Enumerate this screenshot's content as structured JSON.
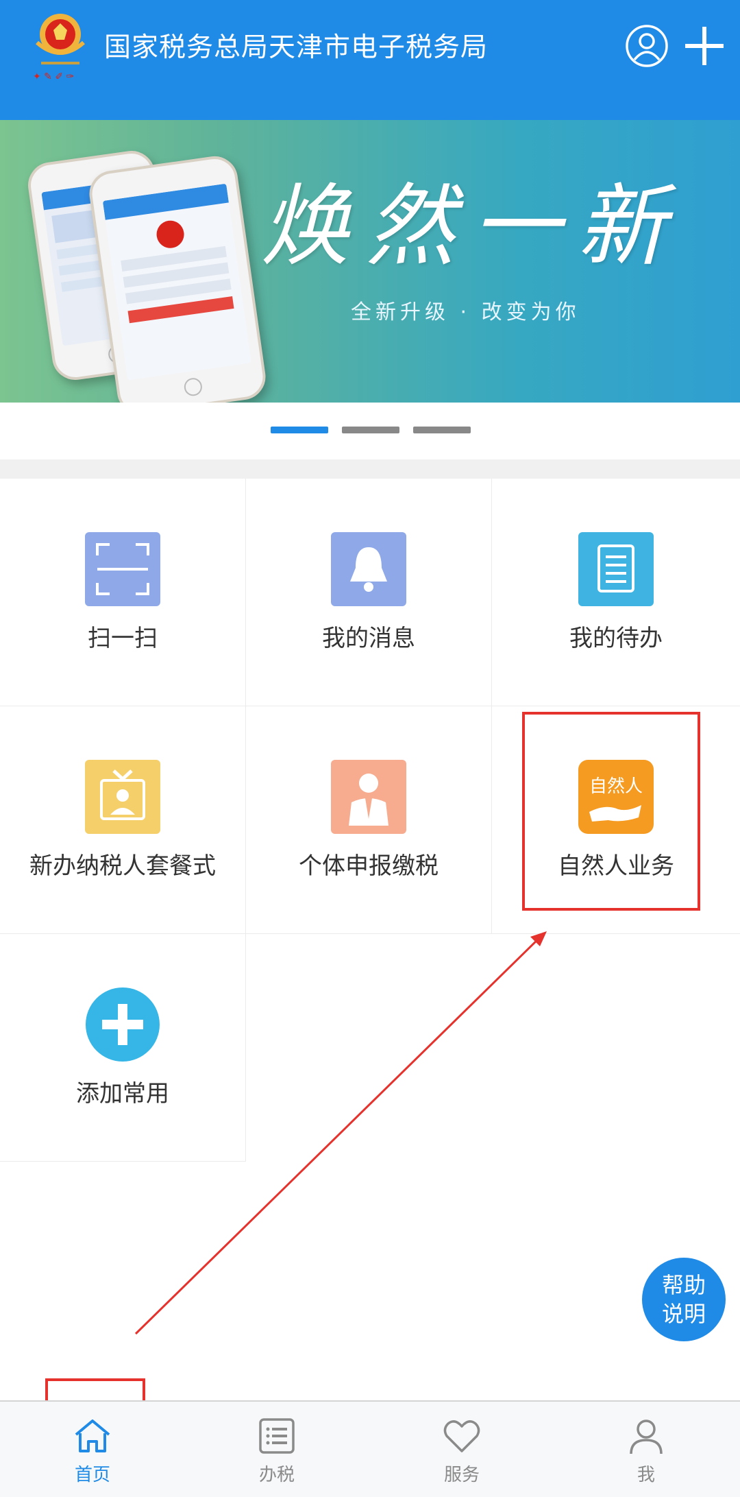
{
  "header": {
    "title": "国家税务总局天津市电子税务局",
    "background": "#1f8be6",
    "icons": [
      "emblem-logo",
      "user-icon",
      "plus-icon"
    ]
  },
  "banner": {
    "headline": "焕然一新",
    "subtitle": "全新升级 · 改变为你",
    "page_count": 3,
    "active_page": 1
  },
  "grid": {
    "items": [
      {
        "label": "扫一扫",
        "icon": "scan-icon",
        "color": "#8fa9e8"
      },
      {
        "label": "我的消息",
        "icon": "bell-icon",
        "color": "#8fa9e8"
      },
      {
        "label": "我的待办",
        "icon": "document-icon",
        "color": "#3fb3e2"
      },
      {
        "label": "新办纳税人套餐式",
        "icon": "gift-icon",
        "color": "#f5cf6a"
      },
      {
        "label": "个体申报缴税",
        "icon": "person-icon",
        "color": "#f7ab8f"
      },
      {
        "label": "自然人业务",
        "icon": "natural-person-icon",
        "icon_text": "自然人",
        "color": "#f59b22"
      },
      {
        "label": "添加常用",
        "icon": "add-circle-icon",
        "color": "#35b6e6"
      }
    ]
  },
  "help": {
    "line1": "帮助",
    "line2": "说明"
  },
  "bottom_nav": {
    "items": [
      {
        "label": "首页",
        "icon": "home-icon",
        "active": true
      },
      {
        "label": "办税",
        "icon": "list-icon",
        "active": false
      },
      {
        "label": "服务",
        "icon": "heart-icon",
        "active": false
      },
      {
        "label": "我",
        "icon": "person-outline-icon",
        "active": false
      }
    ],
    "active_color": "#1f8be6",
    "inactive_color": "#8a8a8a"
  },
  "annotation_color": "#e5322d"
}
